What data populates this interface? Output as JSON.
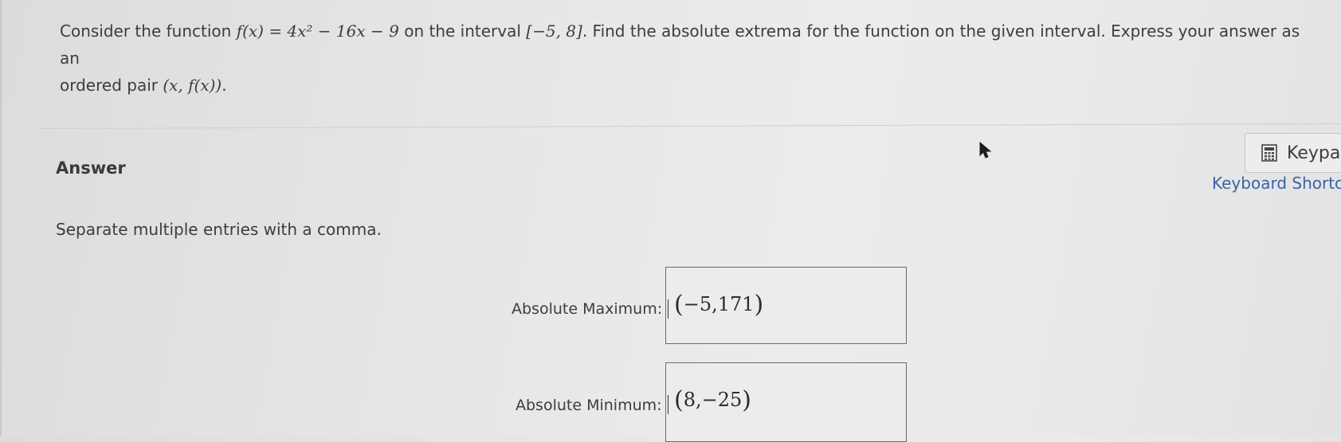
{
  "question": {
    "intro": "Consider the function",
    "function_math": "f(x) = 4x² − 16x − 9",
    "middle": "on the interval",
    "interval": "[−5, 8]",
    "rest_line1": ". Find the absolute extrema for the function on the given interval. Express your answer as an",
    "line2": "ordered pair",
    "pair": "(x, f(x))",
    "end": "."
  },
  "answer": {
    "heading": "Answer",
    "instructions": "Separate multiple entries with a comma.",
    "fields": [
      {
        "label": "Absolute Maximum:",
        "value": "−5,171"
      },
      {
        "label": "Absolute Minimum:",
        "value": "8,−25"
      }
    ]
  },
  "keypad": {
    "label": "Keypad",
    "icon": "calculator-icon"
  },
  "shortcuts": {
    "label": "Keyboard Shortcuts"
  }
}
